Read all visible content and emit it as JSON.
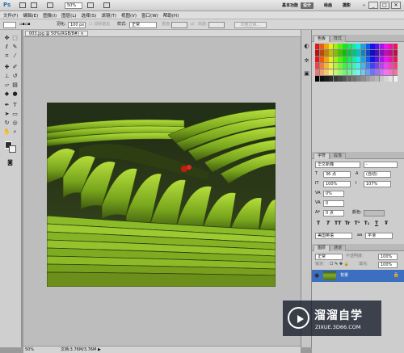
{
  "app": {
    "logo": "Ps",
    "zoom": "50%"
  },
  "workspaces": [
    {
      "label": "基本功能"
    },
    {
      "label": "设计"
    },
    {
      "label": "绘画"
    },
    {
      "label": "摄影"
    },
    {
      "label": "»"
    }
  ],
  "window_controls": [
    "_",
    "□",
    "✕"
  ],
  "menu": [
    "文件(F)",
    "编辑(E)",
    "图像(I)",
    "图层(L)",
    "选择(S)",
    "滤镜(T)",
    "视图(V)",
    "窗口(W)",
    "帮助(H)"
  ],
  "options": {
    "feather_label": "羽化:",
    "feather_value": "100 px",
    "antialias_label": "消除锯齿",
    "style_label": "样式:",
    "style_value": "正常",
    "width_label": "宽度:",
    "height_label": "高度:",
    "refine_edge": "调整边缘..."
  },
  "document": {
    "tab": "003.jpg @ 50%(RGB/8#)",
    "tab_close": "×",
    "status_zoom": "50%",
    "status_doc": "文档:3.76M/3.76M"
  },
  "panels": {
    "swatches_tabs": [
      "色板",
      "样式"
    ],
    "character_tabs": [
      "字符",
      "段落"
    ],
    "layers_tabs": [
      "图层",
      "通道"
    ]
  },
  "character": {
    "font_family": "华文新魏",
    "font_style": "-",
    "size": "36 点",
    "leading": "(自动)",
    "vscale": "100%",
    "hscale": "107%",
    "tracking": "0%",
    "kerning": "0",
    "baseline": "0 点",
    "color_label": "颜色:",
    "language": "美国英语",
    "aa": "aa",
    "aa_mode": "平滑",
    "typo_buttons": [
      "T",
      "T",
      "TT",
      "Tr",
      "T¹",
      "T₁",
      "T",
      "Ŧ"
    ]
  },
  "layers": {
    "blend_mode": "正常",
    "opacity_label": "不透明度:",
    "opacity": "100%",
    "lock_label": "锁定:",
    "fill_label": "填充:",
    "fill": "100%",
    "layer_name": "背景"
  },
  "watermark": {
    "title": "溜溜自学",
    "url": "ZIXUE.3D66.COM"
  },
  "colors": {
    "accent": "#3d6fc0",
    "foreground": "#2d2d2d",
    "background": "#f2f2f2"
  },
  "icons": [
    "move-icon",
    "marquee-icon",
    "lasso-icon",
    "quick-select-icon",
    "crop-icon",
    "eyedropper-icon",
    "heal-icon",
    "brush-icon",
    "stamp-icon",
    "history-brush-icon",
    "eraser-icon",
    "gradient-icon",
    "blur-icon",
    "dodge-icon",
    "pen-icon",
    "type-icon",
    "path-select-icon",
    "shape-icon",
    "hand-icon",
    "zoom-icon",
    "3d-rotate-icon",
    "3d-orbit-icon"
  ]
}
